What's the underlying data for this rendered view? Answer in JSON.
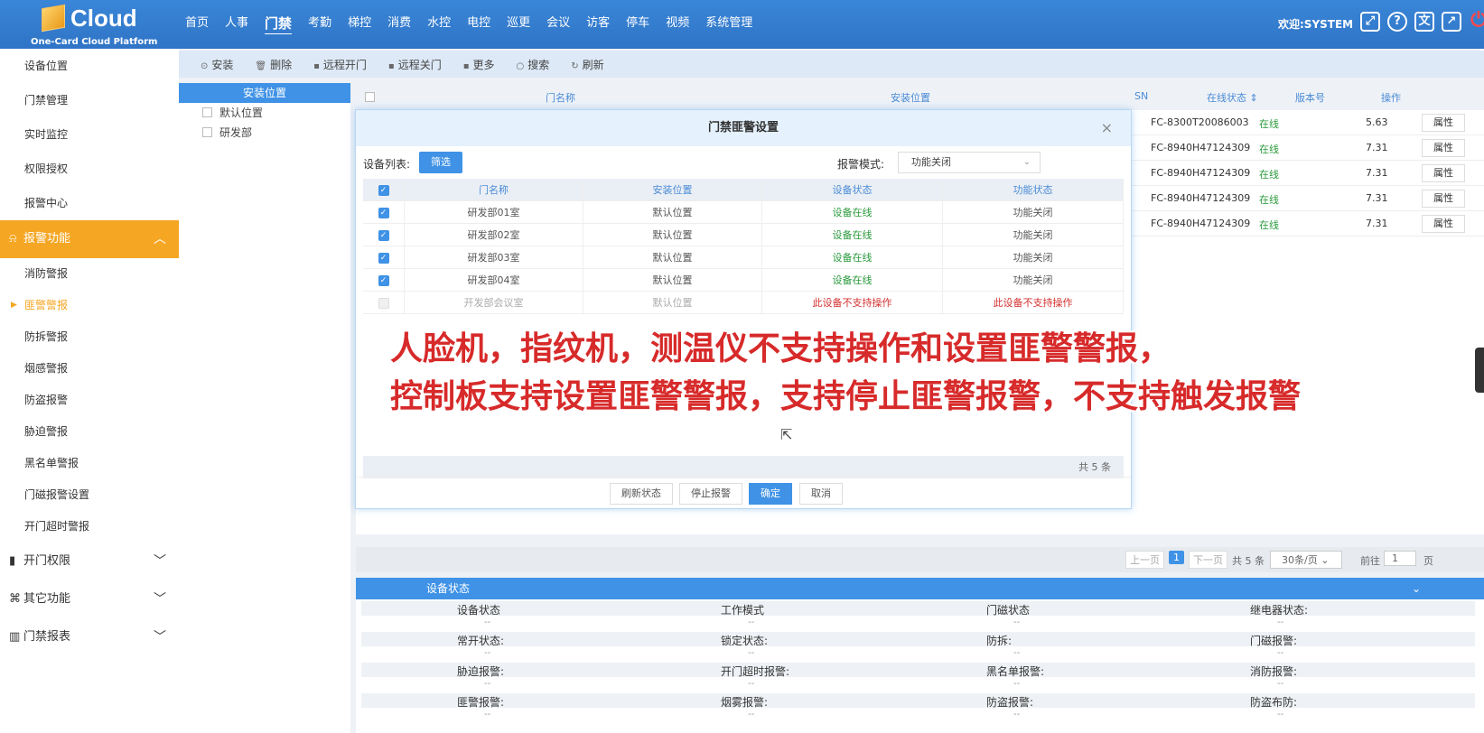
{
  "app": {
    "logo_text": "Cloud",
    "logo_sub": "One-Card Cloud Platform",
    "nav": [
      "首页",
      "人事",
      "门禁",
      "考勤",
      "梯控",
      "消费",
      "水控",
      "电控",
      "巡更",
      "会议",
      "访客",
      "停车",
      "视频",
      "系统管理"
    ],
    "active_nav": "门禁",
    "welcome": "欢迎:SYSTEM",
    "icons": [
      "fullscreen-icon",
      "help-icon",
      "language-icon",
      "open-external-icon",
      "power-icon"
    ]
  },
  "sidebar": {
    "top_items": [
      "设备位置",
      "门禁管理",
      "实时监控",
      "权限授权",
      "报警中心"
    ],
    "open_group": "报警功能",
    "alarm_items": [
      "消防警报",
      "匪警警报",
      "防拆警报",
      "烟感警报",
      "防盗报警",
      "胁迫警报",
      "黑名单警报",
      "门磁报警设置",
      "开门超时警报"
    ],
    "current_item": "匪警警报",
    "groups": [
      "开门权限",
      "其它功能",
      "门禁报表"
    ]
  },
  "toolbar": {
    "buttons": [
      "安装",
      "删除",
      "远程开门",
      "远程关门",
      "更多",
      "搜索",
      "刷新"
    ]
  },
  "tree": {
    "header": "安装位置",
    "nodes": [
      "默认位置",
      "研发部"
    ]
  },
  "grid": {
    "headers": {
      "name": "门名称",
      "location": "安装位置",
      "sn": "SN",
      "online": "在线状态",
      "version": "版本号",
      "action": "操作"
    },
    "rows": [
      {
        "sn": "FC-8300T20086003",
        "online": "在线",
        "version": "5.63",
        "action": "属性"
      },
      {
        "sn": "FC-8940H47124309",
        "online": "在线",
        "version": "7.31",
        "action": "属性"
      },
      {
        "sn": "FC-8940H47124309",
        "online": "在线",
        "version": "7.31",
        "action": "属性"
      },
      {
        "sn": "FC-8940H47124309",
        "online": "在线",
        "version": "7.31",
        "action": "属性"
      },
      {
        "sn": "FC-8940H47124309",
        "online": "在线",
        "version": "7.31",
        "action": "属性"
      }
    ]
  },
  "pager": {
    "prev": "上一页",
    "current": "1",
    "next": "下一页",
    "total": "共 5 条",
    "page_size": "30条/页",
    "goto_label": "前往",
    "goto_value": "1",
    "page_unit": "页"
  },
  "status_panel": {
    "title": "设备状态",
    "rows": [
      [
        "设备状态",
        "工作模式",
        "门磁状态",
        "继电器状态:"
      ],
      [
        "常开状态:",
        "锁定状态:",
        "防拆:",
        "门磁报警:"
      ],
      [
        "胁迫报警:",
        "开门超时报警:",
        "黑名单报警:",
        "消防报警:"
      ],
      [
        "匪警报警:",
        "烟雾报警:",
        "防盗报警:",
        "防盗布防:"
      ]
    ],
    "empty_value": "--"
  },
  "modal": {
    "title": "门禁匪警设置",
    "close": "×",
    "device_list_label": "设备列表:",
    "filter_button": "筛选",
    "alarm_mode_label": "报警模式:",
    "alarm_mode_value": "功能关闭",
    "headers": [
      "门名称",
      "安装位置",
      "设备状态",
      "功能状态"
    ],
    "rows": [
      {
        "checked": true,
        "name": "研发部01室",
        "location": "默认位置",
        "device_status": "设备在线",
        "function_status": "功能关闭"
      },
      {
        "checked": true,
        "name": "研发部02室",
        "location": "默认位置",
        "device_status": "设备在线",
        "function_status": "功能关闭"
      },
      {
        "checked": true,
        "name": "研发部03室",
        "location": "默认位置",
        "device_status": "设备在线",
        "function_status": "功能关闭"
      },
      {
        "checked": true,
        "name": "研发部04室",
        "location": "默认位置",
        "device_status": "设备在线",
        "function_status": "功能关闭"
      },
      {
        "checked": false,
        "name": "开发部会议室",
        "location": "默认位置",
        "device_status": "此设备不支持操作",
        "function_status": "此设备不支持操作"
      }
    ],
    "total": "共 5 条",
    "buttons": {
      "refresh": "刷新状态",
      "stop": "停止报警",
      "ok": "确定",
      "cancel": "取消"
    }
  },
  "overlay": {
    "line1": "人脸机，指纹机，测温仪不支持操作和设置匪警警报，",
    "line2": "控制板支持设置匪警警报，支持停止匪警报警，不支持触发报警"
  }
}
